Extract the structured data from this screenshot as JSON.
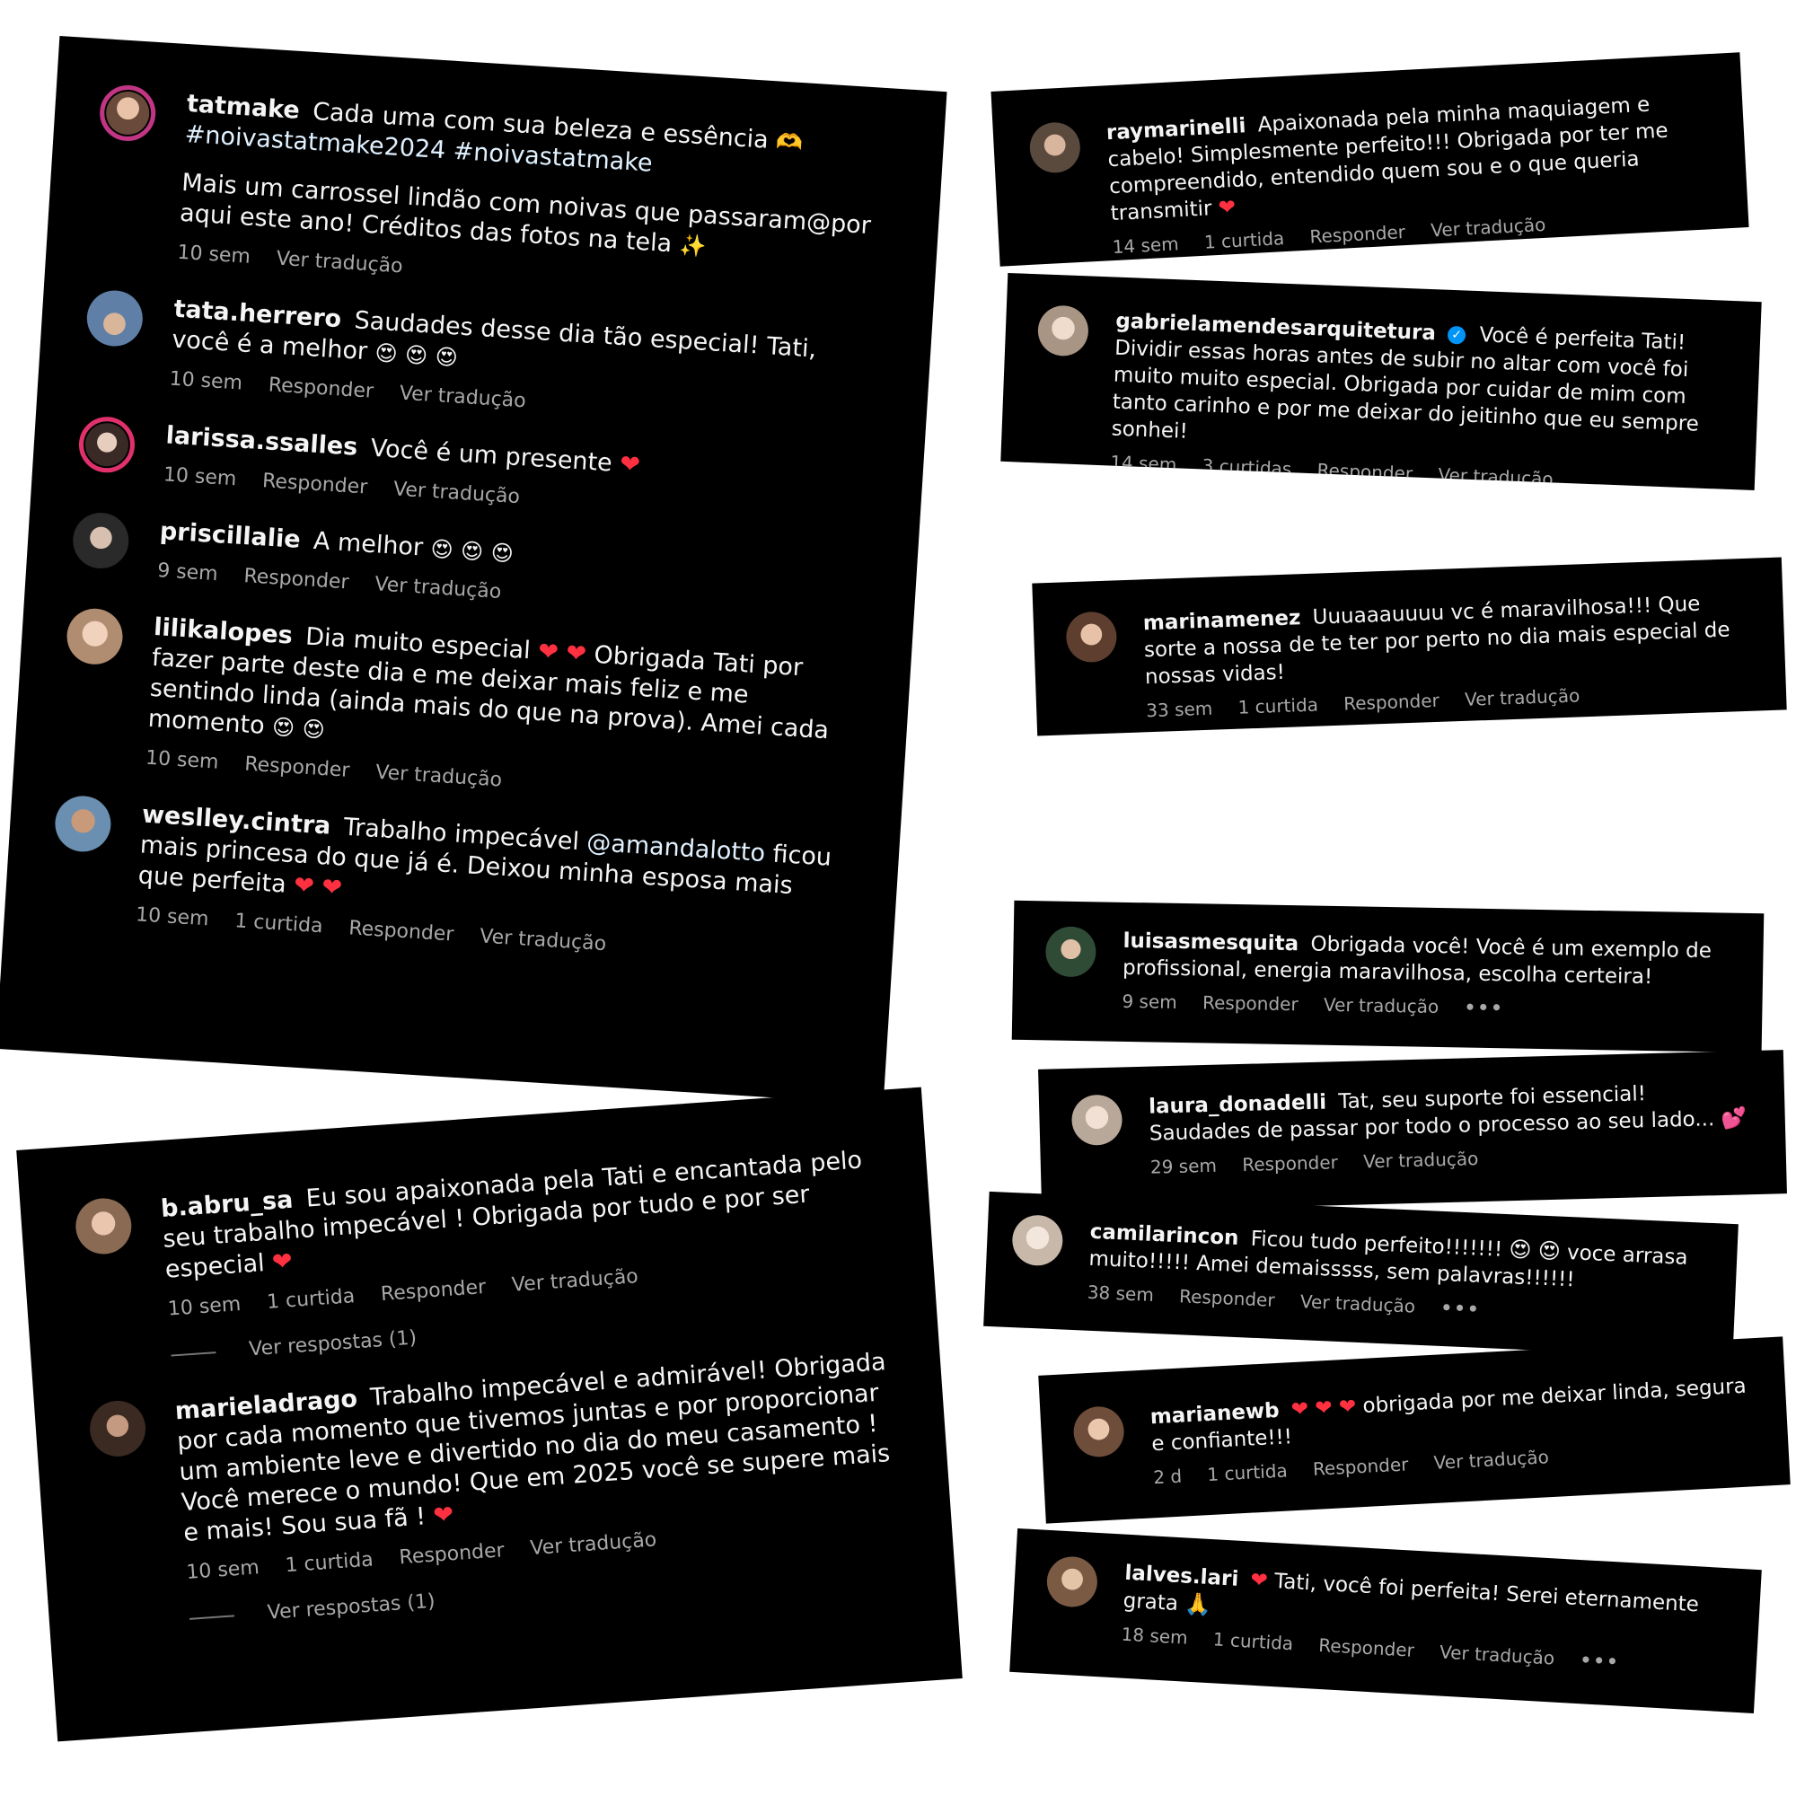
{
  "colors": {
    "card_bg": "#000000",
    "text": "#f5f5f5",
    "meta": "#a8a8a8",
    "heart": "#ff3040",
    "verified": "#0095f6",
    "page_bg": "#ffffff"
  },
  "icons": {
    "heart": "❤",
    "heart_eyes": "😍",
    "sparkles": "✨",
    "hands_heart": "🫶",
    "two_hearts": "💕",
    "pray": "🙏",
    "verified": "✓",
    "more": "•••"
  },
  "main": {
    "caption": {
      "user": "tatmake",
      "text": "Cada uma com sua beleza e essência",
      "tags": "#noivastatmake2024 #noivastatmake",
      "body": "Mais um carrossel lindão com noivas que passaram@por aqui este ano! Créditos das fotos na tela",
      "time": "10 sem",
      "translate": "Ver tradução"
    },
    "comments": [
      {
        "user": "tata.herrero",
        "text": "Saudades desse dia tão especial! Tati, você é a melhor",
        "time": "10 sem",
        "likes": "",
        "reply": "Responder",
        "translate": "Ver tradução"
      },
      {
        "user": "larissa.ssalles",
        "text": "Você é um presente",
        "time": "10 sem",
        "likes": "",
        "reply": "Responder",
        "translate": "Ver tradução"
      },
      {
        "user": "priscillalie",
        "text": "A melhor",
        "time": "9 sem",
        "likes": "",
        "reply": "Responder",
        "translate": "Ver tradução"
      },
      {
        "user": "lilikalopes",
        "text": "Dia muito especial",
        "text2": "Obrigada Tati por fazer parte deste dia e me deixar mais feliz e me sentindo linda (ainda mais do que na prova). Amei cada momento",
        "time": "10 sem",
        "likes": "",
        "reply": "Responder",
        "translate": "Ver tradução"
      },
      {
        "user": "weslley.cintra",
        "text": "Trabalho impecável",
        "mention": "@amandalotto",
        "text2": "ficou mais princesa do que já é. Deixou minha esposa mais que perfeita",
        "time": "10 sem",
        "likes": "1 curtida",
        "reply": "Responder",
        "translate": "Ver tradução"
      }
    ]
  },
  "bottom_left": {
    "comments": [
      {
        "user": "b.abru_sa",
        "text": "Eu sou apaixonada pela Tati e encantada pelo seu trabalho impecável ! Obrigada por tudo e por ser especial",
        "time": "10 sem",
        "likes": "1 curtida",
        "reply": "Responder",
        "translate": "Ver tradução",
        "replies": "Ver respostas (1)"
      },
      {
        "user": "marieladrago",
        "text": "Trabalho impecável e admirável! Obrigada por cada momento que tivemos juntas e por proporcionar um ambiente leve e divertido no dia do meu casamento ! Você merece o mundo! Que em 2025 você se supere mais e mais! Sou sua fã !",
        "time": "10 sem",
        "likes": "1 curtida",
        "reply": "Responder",
        "translate": "Ver tradução",
        "replies": "Ver respostas (1)"
      }
    ]
  },
  "right": [
    {
      "user": "raymarinelli",
      "text": "Apaixonada pela minha maquiagem e cabelo! Simplesmente perfeito!!! Obrigada por ter me compreendido, entendido quem sou e o que queria transmitir",
      "time": "14 sem",
      "likes": "1 curtida",
      "reply": "Responder",
      "translate": "Ver tradução"
    },
    {
      "user": "gabrielamendesarquitetura",
      "text": "Você é perfeita Tati! Dividir essas horas antes de subir no altar com você foi muito muito especial. Obrigada por cuidar de mim com tanto carinho e por me deixar do jeitinho que eu sempre sonhei!",
      "time": "14 sem",
      "likes": "3 curtidas",
      "reply": "Responder",
      "translate": "Ver tradução"
    },
    {
      "user": "marinamenez",
      "text": "Uuuaaauuuu vc é maravilhosa!!! Que sorte a nossa de te ter por perto no dia mais especial de nossas vidas!",
      "time": "33 sem",
      "likes": "1 curtida",
      "reply": "Responder",
      "translate": "Ver tradução"
    },
    {
      "user": "luisasmesquita",
      "text": "Obrigada você! Você é um exemplo de profissional, energia maravilhosa, escolha certeira!",
      "time": "9 sem",
      "likes": "",
      "reply": "Responder",
      "translate": "Ver tradução"
    },
    {
      "user": "laura_donadelli",
      "text": "Tat, seu suporte foi essencial! Saudades de passar por todo o processo ao seu lado...",
      "time": "29 sem",
      "likes": "",
      "reply": "Responder",
      "translate": "Ver tradução"
    },
    {
      "user": "camilarincon",
      "text": "Ficou tudo perfeito!!!!!!!",
      "text2": "voce arrasa muito!!!!! Amei demaisssss, sem palavras!!!!!!",
      "time": "38 sem",
      "likes": "",
      "reply": "Responder",
      "translate": "Ver tradução"
    },
    {
      "user": "marianewb",
      "text": "obrigada por me deixar linda, segura e confiante!!!",
      "time": "2 d",
      "likes": "1 curtida",
      "reply": "Responder",
      "translate": "Ver tradução"
    },
    {
      "user": "lalves.lari",
      "text": "Tati, você foi perfeita! Serei eternamente grata",
      "time": "18 sem",
      "likes": "1 curtida",
      "reply": "Responder",
      "translate": "Ver tradução"
    }
  ]
}
